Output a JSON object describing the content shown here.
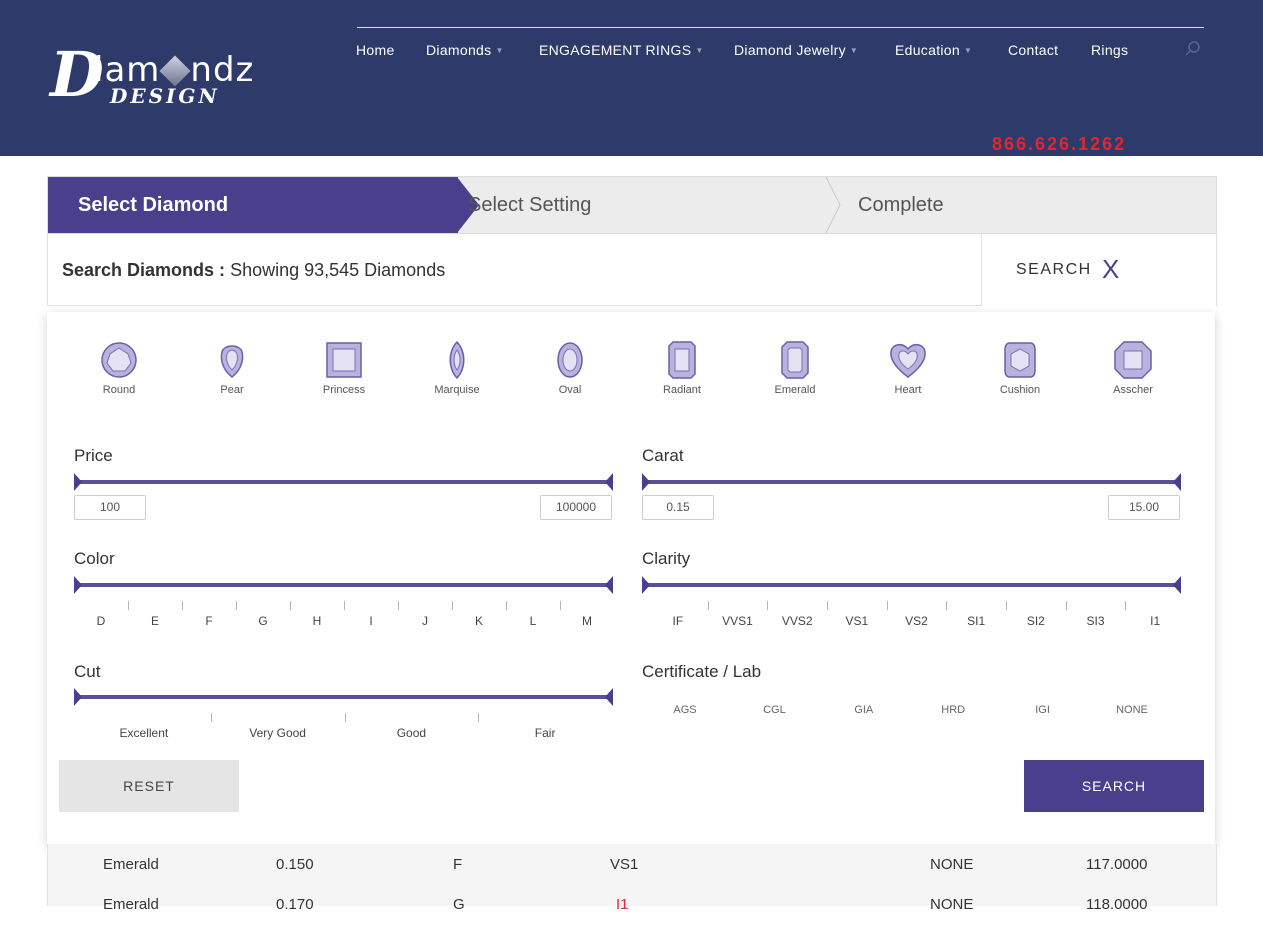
{
  "header": {
    "logo_main": "iam",
    "logo_main_tail": "ndz",
    "logo_sub": "DESIGN",
    "nav": [
      {
        "label": "Home",
        "caret": false
      },
      {
        "label": "Diamonds",
        "caret": true
      },
      {
        "label": "ENGAGEMENT RINGS",
        "caret": true
      },
      {
        "label": "Diamond Jewelry",
        "caret": true
      },
      {
        "label": "Education",
        "caret": true
      },
      {
        "label": "Contact",
        "caret": false
      },
      {
        "label": "Rings",
        "caret": false
      }
    ],
    "phone": "866.626.1262"
  },
  "steps": {
    "active": "Select Diamond",
    "setting": "Select Setting",
    "complete": "Complete"
  },
  "search": {
    "title_bold": "Search Diamonds :",
    "title_rest": "Showing 93,545 Diamonds",
    "toggle_label": "SEARCH",
    "toggle_icon": "X"
  },
  "shapes": [
    "Round",
    "Pear",
    "Princess",
    "Marquise",
    "Oval",
    "Radiant",
    "Emerald",
    "Heart",
    "Cushion",
    "Asscher"
  ],
  "filters": {
    "price": {
      "title": "Price",
      "min": "100",
      "max": "100000"
    },
    "carat": {
      "title": "Carat",
      "min": "0.15",
      "max": "15.00"
    },
    "color": {
      "title": "Color",
      "labels": [
        "D",
        "E",
        "F",
        "G",
        "H",
        "I",
        "J",
        "K",
        "L",
        "M"
      ]
    },
    "clarity": {
      "title": "Clarity",
      "labels": [
        "IF",
        "VVS1",
        "VVS2",
        "VS1",
        "VS2",
        "SI1",
        "SI2",
        "SI3",
        "I1"
      ]
    },
    "cut": {
      "title": "Cut",
      "labels": [
        "Excellent",
        "Very Good",
        "Good",
        "Fair"
      ]
    },
    "lab": {
      "title": "Certificate / Lab",
      "labels": [
        "AGS",
        "CGL",
        "GIA",
        "HRD",
        "IGI",
        "NONE"
      ]
    }
  },
  "buttons": {
    "reset": "RESET",
    "search": "SEARCH"
  },
  "table": {
    "rows": [
      [
        "Emerald",
        "0.150",
        "F",
        "VS1",
        "NONE",
        "117.0000"
      ],
      [
        "Emerald",
        "0.170",
        "G",
        "I1",
        "NONE",
        "118.0000"
      ]
    ]
  },
  "colors": {
    "header_bg": "#2e3a6a",
    "accent": "#4a3f8c",
    "phone": "#e2262f"
  }
}
